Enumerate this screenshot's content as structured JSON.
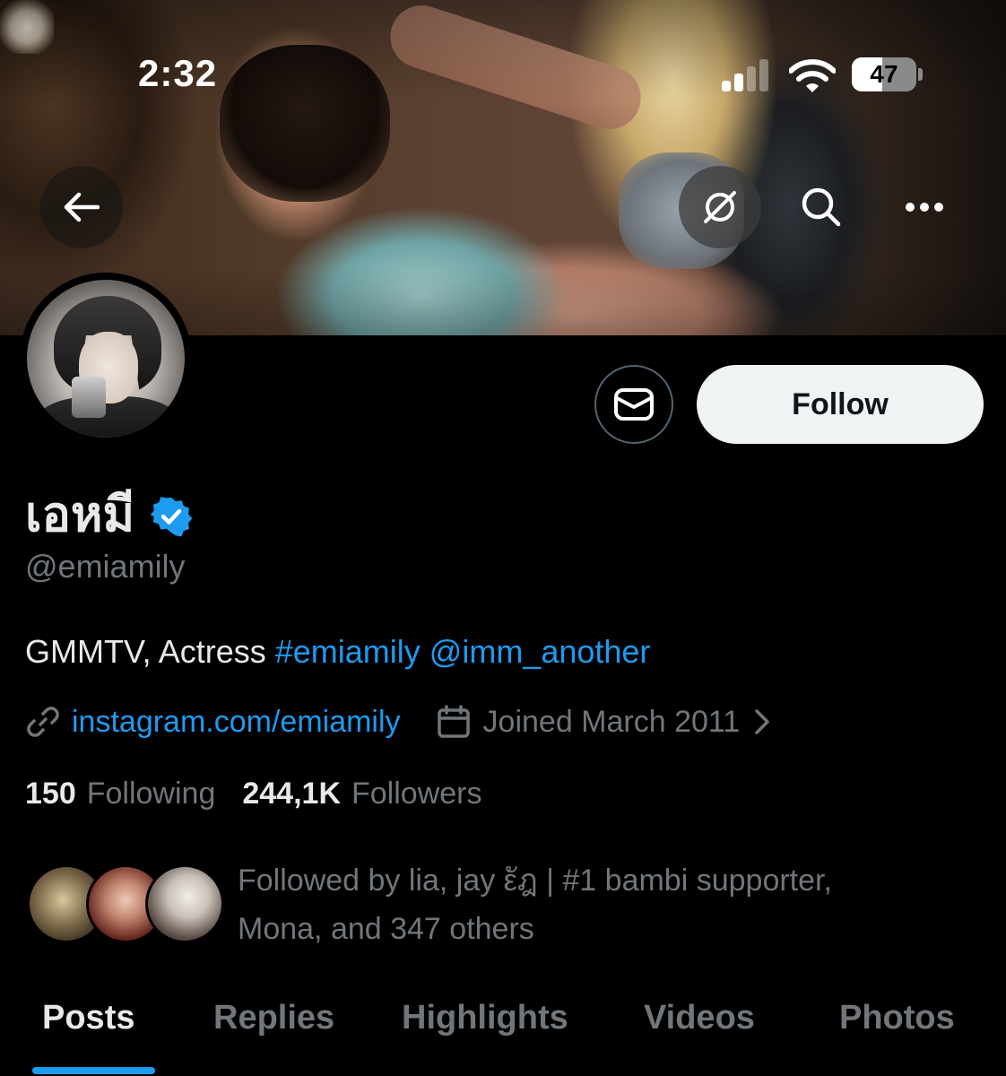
{
  "status_bar": {
    "time": "2:32",
    "battery": "47",
    "battery_level": 0.47
  },
  "nav": {
    "back_icon": "arrow-left-icon",
    "grok_icon": "grok-icon",
    "search_icon": "search-icon",
    "more_icon": "more-horizontal-icon"
  },
  "profile": {
    "display_name": "เอหมี",
    "handle": "@emiamily",
    "verified": true,
    "bio_text": "GMMTV, Actress ",
    "bio_hashtag": "#emiamily",
    "bio_mention": "@imm_another",
    "website": "instagram.com/emiamily",
    "joined": "Joined March 2011",
    "following_count": "150",
    "following_label": "Following",
    "followers_count": "244,1K",
    "followers_label": "Followers",
    "followed_by_line1": "Followed by lia, jay ε̱е̨è | #1 bambi supporter,",
    "followed_by_line2": "Mona, and 347 others"
  },
  "actions": {
    "follow_label": "Follow",
    "message_icon": "envelope-icon"
  },
  "tabs": [
    {
      "label": "Posts",
      "active": true
    },
    {
      "label": "Replies",
      "active": false
    },
    {
      "label": "Highlights",
      "active": false
    },
    {
      "label": "Videos",
      "active": false
    },
    {
      "label": "Photos",
      "active": false
    }
  ],
  "colors": {
    "accent": "#1d9bf0",
    "muted": "#71767b",
    "text": "#e7e9ea",
    "background": "#000000"
  }
}
